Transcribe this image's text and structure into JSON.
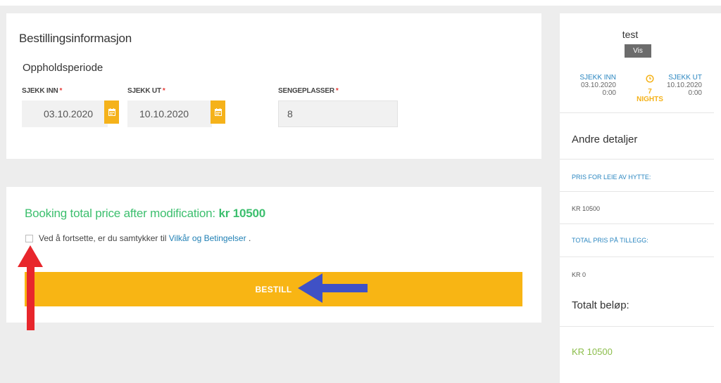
{
  "booking": {
    "title": "Bestillingsinformasjon",
    "period_heading": "Oppholdsperiode",
    "checkin_label": "SJEKK INN",
    "checkout_label": "SJEKK UT",
    "beds_label": "SENGEPLASSER",
    "required_mark": "*",
    "checkin_value": "03.10.2020",
    "checkout_value": "10.10.2020",
    "beds_value": "8",
    "calendar_icon": "calendar-icon"
  },
  "summary": {
    "total_prefix": "Booking total price after modification:",
    "total_amount": "kr 10500",
    "terms_text": "Ved å fortsette, er du samtykker til",
    "terms_link": "Vilkår og Betingelser",
    "terms_suffix": " .",
    "order_button": "BESTILL"
  },
  "sidebar": {
    "name": "test",
    "view_button": "Vis",
    "checkin_label": "SJEKK INN",
    "checkin_date": "03.10.2020",
    "checkin_time": "0:00",
    "nights": "7 NIGHTS",
    "checkout_label": "SJEKK UT",
    "checkout_date": "10.10.2020",
    "checkout_time": "0:00",
    "other_details": "Andre detaljer",
    "rent_label": "PRIS FOR LEIE AV HYTTE:",
    "rent_value": "KR 10500",
    "addons_label": "TOTAL PRIS PÅ TILLEGG:",
    "addons_value": "KR 0",
    "total_heading": "Totalt beløp:",
    "total_value": "KR 10500"
  },
  "colors": {
    "accent_yellow": "#f8b514",
    "success_green": "#3cbf6e",
    "link_blue": "#2a86c0",
    "annotation_red": "#e8262c",
    "annotation_blue": "#3f51c6"
  }
}
